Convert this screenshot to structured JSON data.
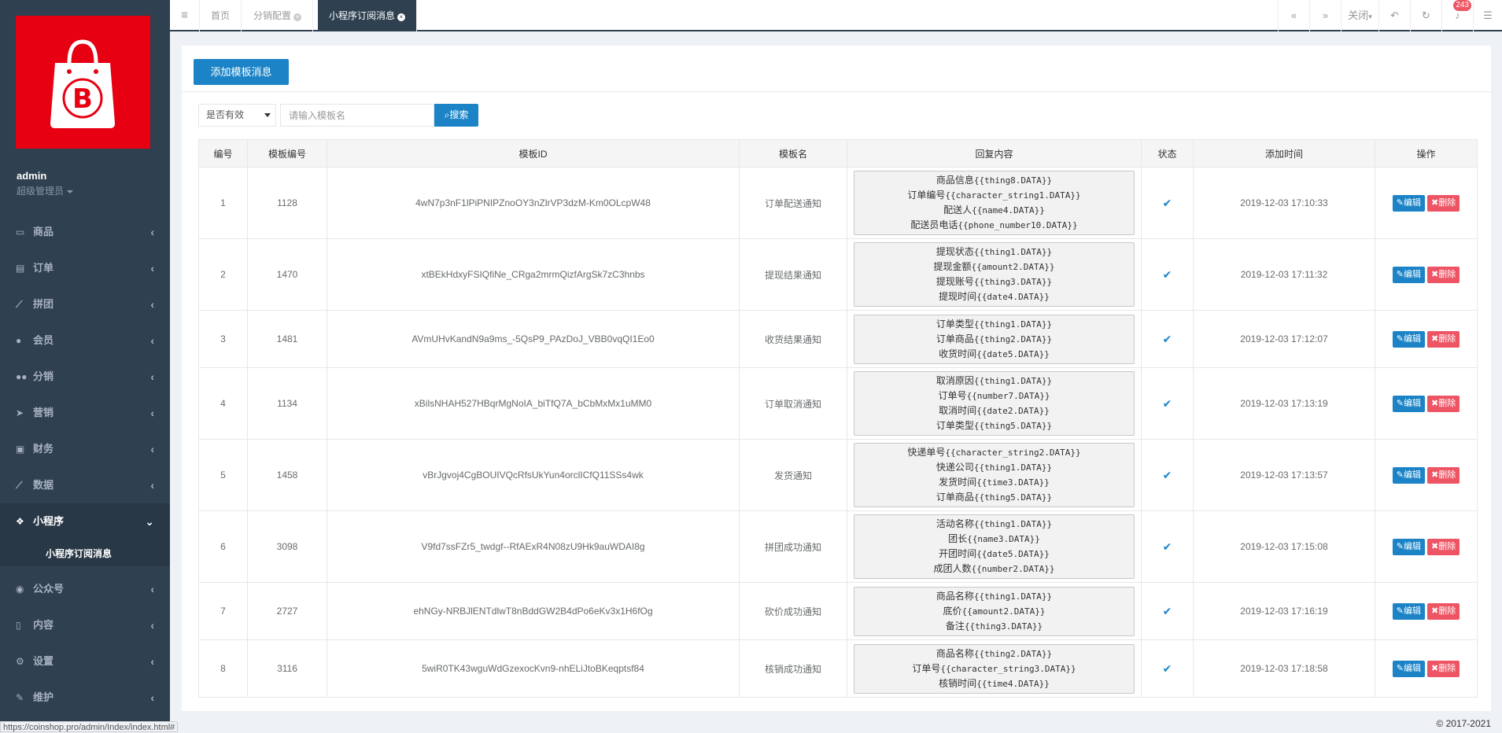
{
  "sidebar": {
    "user_name": "admin",
    "user_role": "超级管理员",
    "items": [
      {
        "label": "商品",
        "icon": "laptop-icon"
      },
      {
        "label": "订单",
        "icon": "list-icon"
      },
      {
        "label": "拼团",
        "icon": "line-chart-icon"
      },
      {
        "label": "会员",
        "icon": "user-icon"
      },
      {
        "label": "分销",
        "icon": "users-icon"
      },
      {
        "label": "营销",
        "icon": "paper-plane-icon"
      },
      {
        "label": "财务",
        "icon": "money-icon"
      },
      {
        "label": "数据",
        "icon": "area-chart-icon"
      },
      {
        "label": "小程序",
        "icon": "cubes-icon"
      },
      {
        "label": "公众号",
        "icon": "wechat-icon"
      },
      {
        "label": "内容",
        "icon": "book-icon"
      },
      {
        "label": "设置",
        "icon": "gear-icon"
      },
      {
        "label": "维护",
        "icon": "wrench-icon"
      }
    ],
    "sub_item": "小程序订阅消息"
  },
  "topbar": {
    "tabs": [
      {
        "label": "首页"
      },
      {
        "label": "分销配置"
      },
      {
        "label": "小程序订阅消息"
      }
    ],
    "close_label": "关闭",
    "badge": "243"
  },
  "toolbar": {
    "add_label": "添加模板消息"
  },
  "filter": {
    "select_value": "是否有效",
    "search_placeholder": "请输入模板名",
    "search_label": "搜索"
  },
  "table": {
    "headers": [
      "编号",
      "模板编号",
      "模板ID",
      "模板名",
      "回复内容",
      "状态",
      "添加时间",
      "操作"
    ],
    "edit_label": "编辑",
    "delete_label": "删除",
    "rows": [
      {
        "id": "1",
        "tpl_no": "1128",
        "tpl_id": "4wN7p3nF1lPiPNIPZnoOY3nZlrVP3dzM-Km0OLcpW48",
        "name": "订单配送通知",
        "reply": [
          [
            "商品信息",
            "{{thing8.DATA}}"
          ],
          [
            "订单编号",
            "{{character_string1.DATA}}"
          ],
          [
            "配送人",
            "{{name4.DATA}}"
          ],
          [
            "配送员电话",
            "{{phone_number10.DATA}}"
          ]
        ],
        "time": "2019-12-03 17:10:33"
      },
      {
        "id": "2",
        "tpl_no": "1470",
        "tpl_id": "xtBEkHdxyFSIQfiNe_CRga2mrmQizfArgSk7zC3hnbs",
        "name": "提现结果通知",
        "reply": [
          [
            "提现状态",
            "{{thing1.DATA}}"
          ],
          [
            "提现金额",
            "{{amount2.DATA}}"
          ],
          [
            "提现账号",
            "{{thing3.DATA}}"
          ],
          [
            "提现时间",
            "{{date4.DATA}}"
          ]
        ],
        "time": "2019-12-03 17:11:32"
      },
      {
        "id": "3",
        "tpl_no": "1481",
        "tpl_id": "AVmUHvKandN9a9ms_-5QsP9_PAzDoJ_VBB0vqQI1Eo0",
        "name": "收货结果通知",
        "reply": [
          [
            "订单类型",
            "{{thing1.DATA}}"
          ],
          [
            "订单商品",
            "{{thing2.DATA}}"
          ],
          [
            "收货时间",
            "{{date5.DATA}}"
          ]
        ],
        "time": "2019-12-03 17:12:07"
      },
      {
        "id": "4",
        "tpl_no": "1134",
        "tpl_id": "xBilsNHAH527HBqrMgNoIA_biTfQ7A_bCbMxMx1uMM0",
        "name": "订单取消通知",
        "reply": [
          [
            "取消原因",
            "{{thing1.DATA}}"
          ],
          [
            "订单号",
            "{{number7.DATA}}"
          ],
          [
            "取消时间",
            "{{date2.DATA}}"
          ],
          [
            "订单类型",
            "{{thing5.DATA}}"
          ]
        ],
        "time": "2019-12-03 17:13:19"
      },
      {
        "id": "5",
        "tpl_no": "1458",
        "tpl_id": "vBrJgvoj4CgBOUIVQcRfsUkYun4orclICfQ11SSs4wk",
        "name": "发货通知",
        "reply": [
          [
            "快递单号",
            "{{character_string2.DATA}}"
          ],
          [
            "快递公司",
            "{{thing1.DATA}}"
          ],
          [
            "发货时间",
            "{{time3.DATA}}"
          ],
          [
            "订单商品",
            "{{thing5.DATA}}"
          ]
        ],
        "time": "2019-12-03 17:13:57"
      },
      {
        "id": "6",
        "tpl_no": "3098",
        "tpl_id": "V9fd7ssFZr5_twdgf--RfAExR4N08zU9Hk9auWDAI8g",
        "name": "拼团成功通知",
        "reply": [
          [
            "活动名称",
            "{{thing1.DATA}}"
          ],
          [
            "团长",
            "{{name3.DATA}}"
          ],
          [
            "开团时间",
            "{{date5.DATA}}"
          ],
          [
            "成团人数",
            "{{number2.DATA}}"
          ]
        ],
        "time": "2019-12-03 17:15:08"
      },
      {
        "id": "7",
        "tpl_no": "2727",
        "tpl_id": "ehNGy-NRBJlENTdlwT8nBddGW2B4dPo6eKv3x1H6fOg",
        "name": "砍价成功通知",
        "reply": [
          [
            "商品名称",
            "{{thing1.DATA}}"
          ],
          [
            "底价",
            "{{amount2.DATA}}"
          ],
          [
            "备注",
            "{{thing3.DATA}}"
          ]
        ],
        "time": "2019-12-03 17:16:19"
      },
      {
        "id": "8",
        "tpl_no": "3116",
        "tpl_id": "5wiR0TK43wguWdGzexocKvn9-nhELiJtoBKeqptsf84",
        "name": "核销成功通知",
        "reply": [
          [
            "商品名称",
            "{{thing2.DATA}}"
          ],
          [
            "订单号",
            "{{character_string3.DATA}}"
          ],
          [
            "核销时间",
            "{{time4.DATA}}"
          ]
        ],
        "time": "2019-12-03 17:18:58"
      }
    ]
  },
  "statusbar": "https://coinshop.pro/admin/Index/index.html#",
  "footer": "© 2017-2021"
}
